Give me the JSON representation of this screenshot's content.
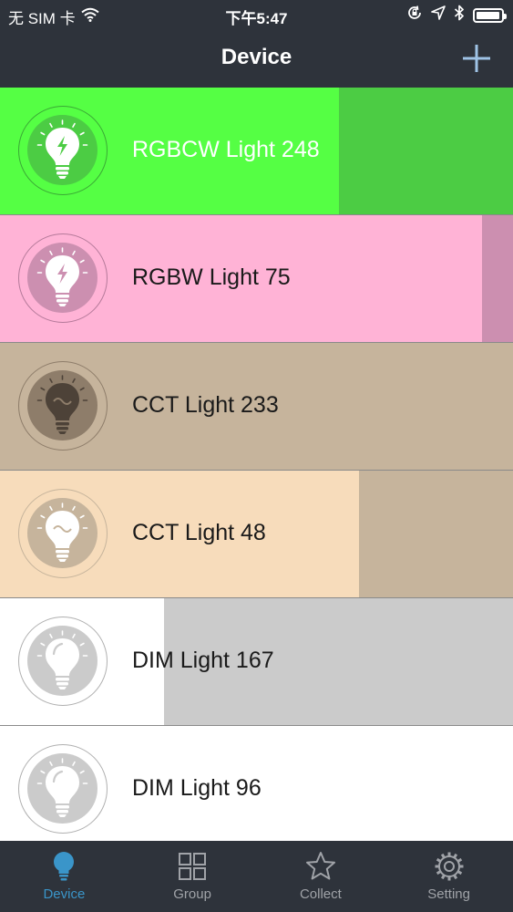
{
  "status_bar": {
    "carrier": "无 SIM 卡",
    "time": "下午5:47",
    "battery_level": 0.95
  },
  "nav": {
    "title": "Device",
    "add_icon": "plus-icon"
  },
  "devices": [
    {
      "name": "RGBCW Light 248",
      "brightness": 0.66,
      "icon": "bulb-rgb-icon",
      "colors": {
        "fill": "#55ff44",
        "rest": "#4ccc44",
        "disc": "#4ccc44",
        "ring": "#3aaa35",
        "bulb": "#ffffff",
        "glyph": "#4ccc44",
        "text": "#ffffff"
      }
    },
    {
      "name": "RGBW Light 75",
      "brightness": 0.94,
      "icon": "bulb-rgb-icon",
      "colors": {
        "fill": "#ffb3d6",
        "rest": "#cc8fb0",
        "disc": "#cc8fb0",
        "ring": "#b57a9a",
        "bulb": "#ffffff",
        "glyph": "#cc8fb0",
        "text": "#1a1a1a"
      }
    },
    {
      "name": "CCT Light 233",
      "brightness": 1.0,
      "icon": "bulb-cct-icon",
      "colors": {
        "fill": "#c6b49c",
        "rest": "#c6b49c",
        "disc": "#8e7d6a",
        "ring": "#8e7d6a",
        "bulb": "#4d4238",
        "glyph": "#8e7d6a",
        "text": "#1a1a1a"
      }
    },
    {
      "name": "CCT Light 48",
      "brightness": 0.7,
      "icon": "bulb-cct-icon",
      "colors": {
        "fill": "#f7dcbb",
        "rest": "#c6b49c",
        "disc": "#c6b49c",
        "ring": "#c6b49c",
        "bulb": "#ffffff",
        "glyph": "#c6b49c",
        "text": "#1a1a1a"
      }
    },
    {
      "name": "DIM Light 167",
      "brightness": 0.32,
      "icon": "bulb-dim-icon",
      "colors": {
        "fill": "#ffffff",
        "rest": "#cbcbcb",
        "disc": "#cbcbcb",
        "ring": "#b0b0b0",
        "bulb": "#ffffff",
        "glyph": "#cbcbcb",
        "text": "#1a1a1a"
      }
    },
    {
      "name": "DIM Light 96",
      "brightness": 1.0,
      "icon": "bulb-dim-icon",
      "colors": {
        "fill": "#ffffff",
        "rest": "#ffffff",
        "disc": "#cbcbcb",
        "ring": "#b0b0b0",
        "bulb": "#ffffff",
        "glyph": "#cbcbcb",
        "text": "#1a1a1a"
      }
    }
  ],
  "tabs": [
    {
      "label": "Device",
      "icon": "bulb-icon",
      "active": true
    },
    {
      "label": "Group",
      "icon": "grid-icon",
      "active": false
    },
    {
      "label": "Collect",
      "icon": "star-icon",
      "active": false
    },
    {
      "label": "Setting",
      "icon": "gear-icon",
      "active": false
    }
  ],
  "theme": {
    "bar_bg": "#2e333b",
    "active_tab": "#3a95c9",
    "inactive_tab": "#a0a3a8"
  }
}
